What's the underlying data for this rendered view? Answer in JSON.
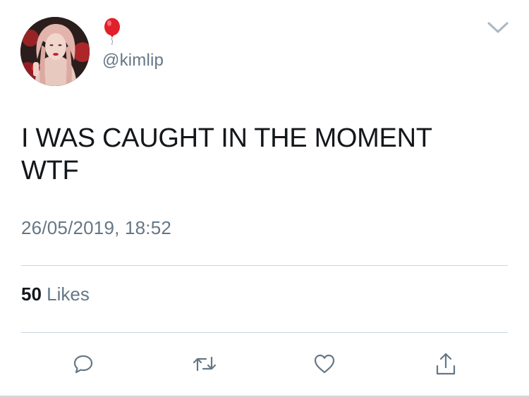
{
  "author": {
    "name_emoji": "🎈",
    "handle": "@kimlip"
  },
  "tweet": {
    "text": "I WAS CAUGHT IN THE MOMENT\nWTF",
    "timestamp": "26/05/2019, 18:52"
  },
  "stats": {
    "likes_count": "50",
    "likes_label": "Likes"
  },
  "icons": {
    "menu": "chevron-down-icon",
    "reply": "reply-icon",
    "retweet": "retweet-icon",
    "like": "heart-icon",
    "share": "share-icon"
  },
  "colors": {
    "text": "#14171a",
    "secondary": "#657786",
    "divider": "#ccd6dd",
    "balloon": "#e0202a"
  }
}
